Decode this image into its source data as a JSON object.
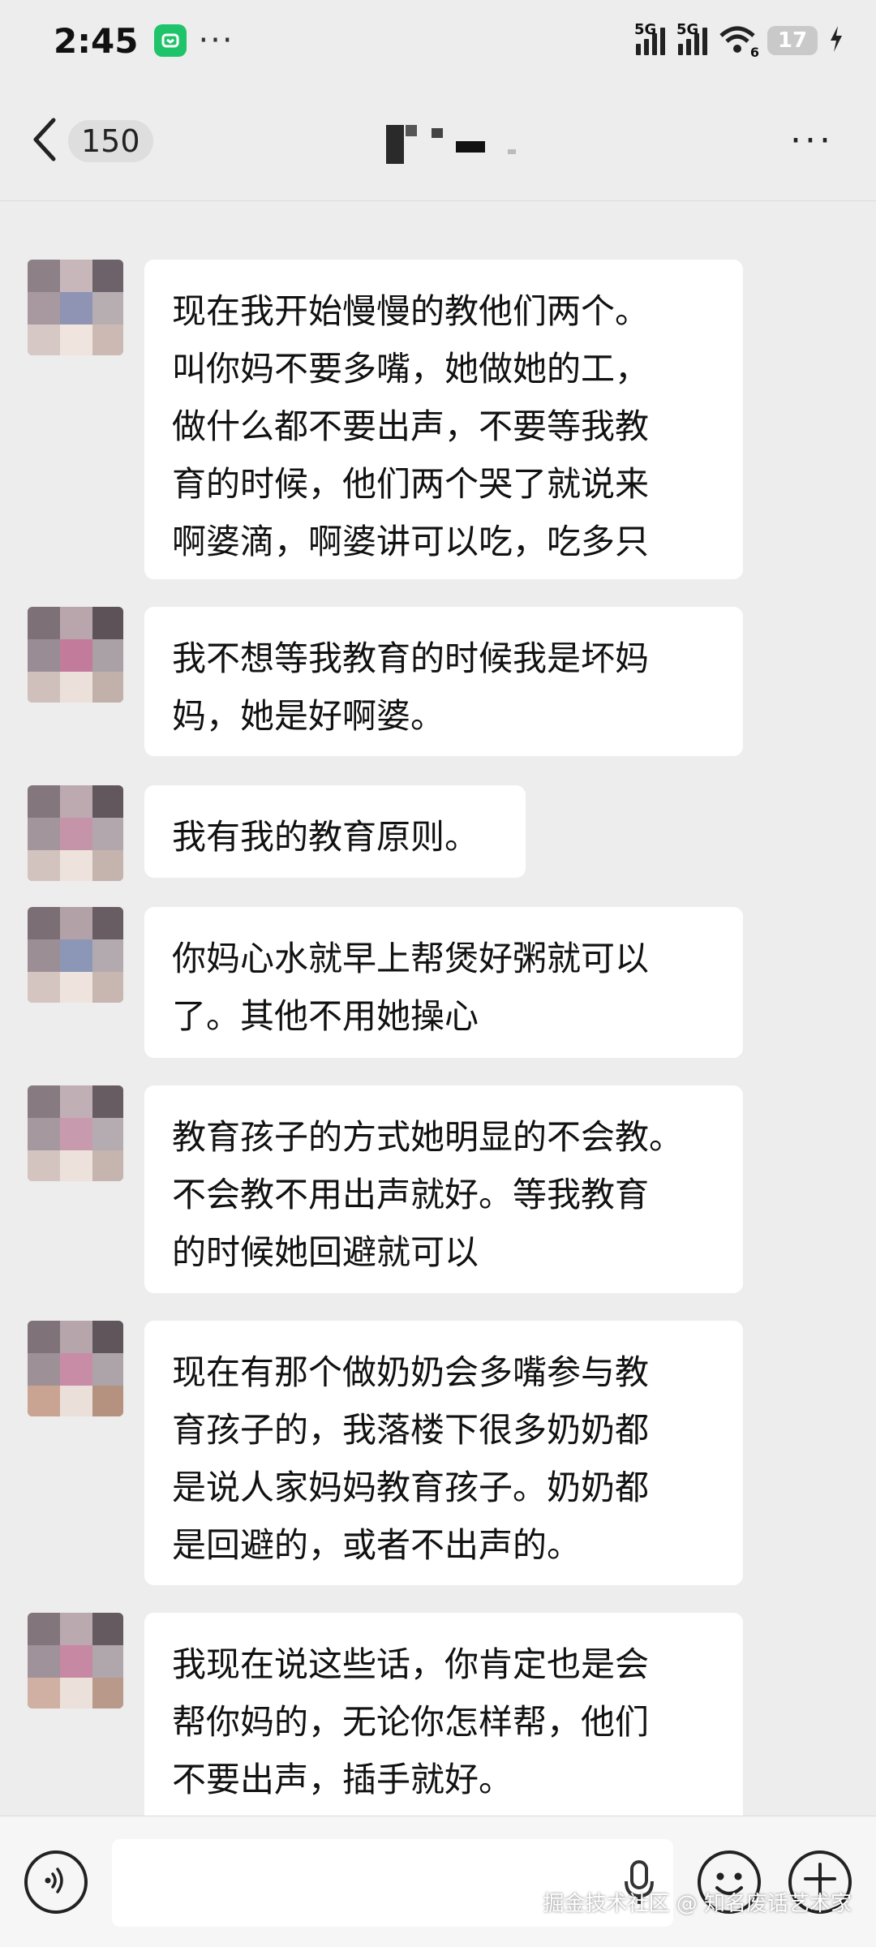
{
  "status_bar": {
    "time": "2:45",
    "dots": "···",
    "signal1_label": "5G",
    "signal2_label": "5G",
    "wifi_label": "6",
    "battery": "17"
  },
  "header": {
    "unread_count": "150",
    "more_label": "···"
  },
  "messages": [
    {
      "lines": [
        "现在我开始慢慢的教他们两个。",
        "叫你妈不要多嘴，她做她的工，",
        "做什么都不要出声，不要等我教",
        "育的时候，他们两个哭了就说来",
        "啊婆滴，啊婆讲可以吃，吃多只"
      ]
    },
    {
      "lines": [
        "我不想等我教育的时候我是坏妈",
        "妈，她是好啊婆。"
      ]
    },
    {
      "lines": [
        "我有我的教育原则。"
      ]
    },
    {
      "lines": [
        "你妈心水就早上帮煲好粥就可以",
        "了。其他不用她操心"
      ]
    },
    {
      "lines": [
        "教育孩子的方式她明显的不会教。",
        "不会教不用出声就好。等我教育",
        "的时候她回避就可以"
      ]
    },
    {
      "lines": [
        "现在有那个做奶奶会多嘴参与教",
        "育孩子的，我落楼下很多奶奶都",
        "是说人家妈妈教育孩子。奶奶都",
        "是回避的，或者不出声的。"
      ]
    },
    {
      "lines": [
        "我现在说这些话，你肯定也是会",
        "帮你妈的，无论你怎样帮，他们",
        "不要出声，插手就好。"
      ]
    }
  ],
  "watermark": "掘金技术社区 @ 知名废话艺术家",
  "colors": {
    "background": "#ededed",
    "bubble": "#ffffff",
    "app_badge": "#1fc46a"
  }
}
